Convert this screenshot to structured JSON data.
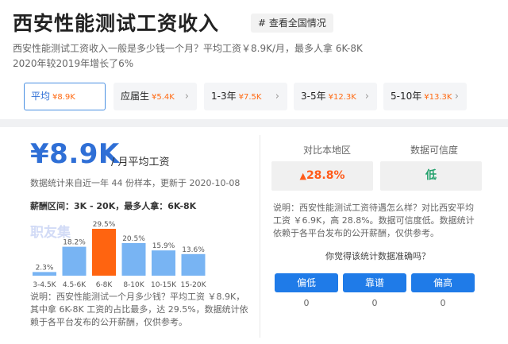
{
  "header": {
    "title": "西安性能测试工资收入",
    "tag": "# 查看全国情况",
    "desc_line1": "西安性能测试工资收入一般是多少钱一个月？平均工资￥8.9K/月，最多人拿 6K-8K",
    "desc_line2": "2020年较2019年增长了6%"
  },
  "tabs": [
    {
      "label": "平均",
      "salary": "¥8.9K",
      "active": true
    },
    {
      "label": "应届生",
      "salary": "¥5.4K"
    },
    {
      "label": "1-3年",
      "salary": "¥7.5K"
    },
    {
      "label": "3-5年",
      "salary": "¥12.3K"
    },
    {
      "label": "5-10年",
      "salary": "¥13.3K"
    }
  ],
  "salary": {
    "big": "¥8.9K",
    "unit": "/ 月平均工资",
    "stat_note": "数据统计来自近一年 44 份样本，更新于 2020-10-08",
    "range": "薪酬区间：3K - 20K，最多人拿：6K-8K",
    "watermark": "职友集",
    "footnote": "说明：西安性能测试一个月多少钱？平均工资 ￥8.9K，其中拿 6K-8K 工资的占比最多，达 29.5%，数据统计依赖于各平台发布的公开薪酬，仅供参考。"
  },
  "chart_data": {
    "type": "bar",
    "categories": [
      "3-4.5K",
      "4.5-6K",
      "6-8K",
      "8-10K",
      "10-15K",
      "15-20K"
    ],
    "values": [
      2.3,
      18.2,
      29.5,
      20.5,
      15.9,
      13.6
    ],
    "value_labels": [
      "2.3%",
      "18.2%",
      "29.5%",
      "20.5%",
      "15.9%",
      "13.6%"
    ],
    "highlight_index": 2,
    "colors": {
      "normal": "#78b4f3",
      "highlight": "#ff6410"
    },
    "ylim": [
      0,
      30
    ]
  },
  "compare": {
    "head1": "对比本地区",
    "head2": "数据可信度",
    "value1": "28.8%",
    "value2": "低",
    "desc": "说明：西安性能测试工资待遇怎么样？对比西安平均工资 ￥6.9K，高 28.8%。数据可信度低。数据统计依赖于各平台发布的公开薪酬，仅供参考。",
    "ask": "你觉得该统计数据准确吗？"
  },
  "vote": [
    {
      "label": "偏低",
      "count": "0"
    },
    {
      "label": "靠谱",
      "count": "0"
    },
    {
      "label": "偏高",
      "count": "0"
    }
  ],
  "colors": {
    "accent": "#1f7be8",
    "orange": "#ff6a13",
    "green": "#22a06b"
  }
}
